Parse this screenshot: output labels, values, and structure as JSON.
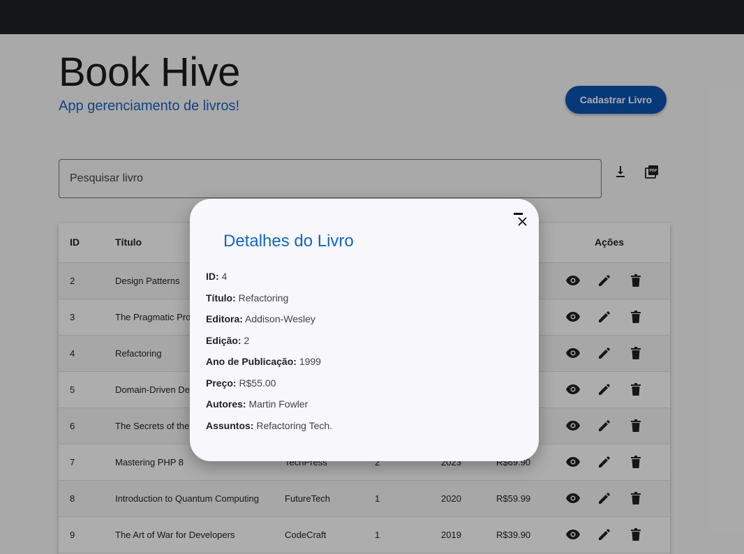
{
  "app": {
    "title": "Book Hive",
    "subtitle": "App gerenciamento de livros!",
    "register_button": "Cadastrar Livro"
  },
  "search": {
    "placeholder": "Pesquisar livro",
    "value": ""
  },
  "toolbar": {
    "download_icon": "download-icon",
    "pdf_icon": "pdf-icon"
  },
  "table": {
    "headers": {
      "id": "ID",
      "title": "Título",
      "actions": "Ações"
    },
    "rows": [
      {
        "id": "2",
        "title": "Design Patterns",
        "publisher": "",
        "edition": "",
        "year": "",
        "price": ""
      },
      {
        "id": "3",
        "title": "The Pragmatic Prog",
        "publisher": "",
        "edition": "",
        "year": "",
        "price": ""
      },
      {
        "id": "4",
        "title": "Refactoring",
        "publisher": "",
        "edition": "",
        "year": "",
        "price": ""
      },
      {
        "id": "5",
        "title": "Domain-Driven Des",
        "publisher": "",
        "edition": "",
        "year": "",
        "price": ""
      },
      {
        "id": "6",
        "title": "The Secrets of the",
        "publisher": "",
        "edition": "",
        "year": "",
        "price": ""
      },
      {
        "id": "7",
        "title": "Mastering PHP 8",
        "publisher": "TechPress",
        "edition": "2",
        "year": "2023",
        "price": "R$69.90"
      },
      {
        "id": "8",
        "title": "Introduction to Quantum Computing",
        "publisher": "FutureTech",
        "edition": "1",
        "year": "2020",
        "price": "R$59.99"
      },
      {
        "id": "9",
        "title": "The Art of War for Developers",
        "publisher": "CodeCraft",
        "edition": "1",
        "year": "2019",
        "price": "R$39.90"
      }
    ]
  },
  "modal": {
    "title": "Detalhes do Livro",
    "fields": [
      {
        "label": "ID:",
        "value": "4"
      },
      {
        "label": "Título:",
        "value": "Refactoring"
      },
      {
        "label": "Editora:",
        "value": "Addison-Wesley"
      },
      {
        "label": "Edição:",
        "value": "2"
      },
      {
        "label": "Ano de Publicação:",
        "value": "1999"
      },
      {
        "label": "Preço:",
        "value": "R$55.00"
      },
      {
        "label": "Autores:",
        "value": "Martin Fowler"
      },
      {
        "label": "Assuntos:",
        "value": "Refactoring Tech."
      }
    ]
  },
  "colors": {
    "topbar": "#1e2227",
    "accent": "#1565c0",
    "button": "#0b54b3",
    "modal_bg": "#f7f7fc"
  }
}
